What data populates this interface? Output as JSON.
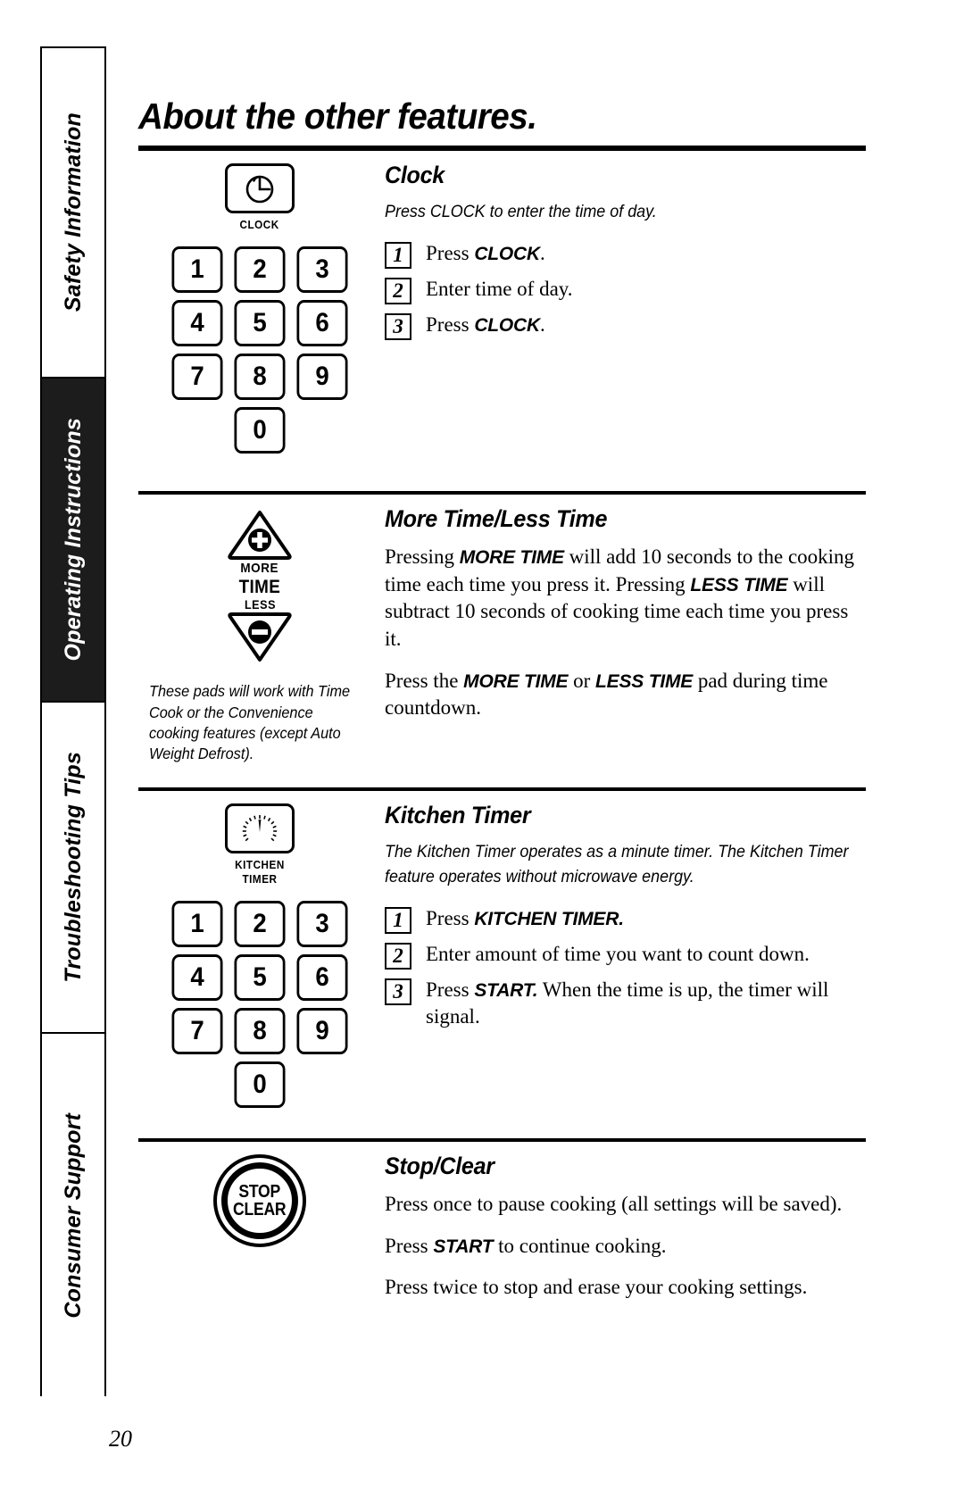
{
  "page": {
    "title": "About the other features.",
    "number": "20"
  },
  "sidebar": {
    "tabs": [
      {
        "label": "Safety Information",
        "active": false
      },
      {
        "label": "Operating Instructions",
        "active": true
      },
      {
        "label": "Troubleshooting Tips",
        "active": false
      },
      {
        "label": "Consumer Support",
        "active": false
      }
    ]
  },
  "sections": {
    "clock": {
      "heading": "Clock",
      "intro": "Press CLOCK to enter the time of day.",
      "pad_label": "CLOCK",
      "pad_icon": "clock-face-icon",
      "steps": [
        {
          "num": "1",
          "pre": "Press ",
          "strong": "CLOCK",
          "post": "."
        },
        {
          "num": "2",
          "pre": "Enter time of day.",
          "strong": "",
          "post": ""
        },
        {
          "num": "3",
          "pre": "Press ",
          "strong": "CLOCK",
          "post": "."
        }
      ],
      "keypad": [
        [
          "1",
          "2",
          "3"
        ],
        [
          "4",
          "5",
          "6"
        ],
        [
          "7",
          "8",
          "9"
        ],
        [
          "0"
        ]
      ]
    },
    "more_less_time": {
      "heading": "More Time/Less Time",
      "pad": {
        "more_label": "MORE",
        "time_label": "TIME",
        "less_label": "LESS",
        "plus_icon": "plus-in-triangle-icon",
        "minus_icon": "minus-in-triangle-icon"
      },
      "note": "These pads will work with Time Cook or the Convenience cooking features (except Auto Weight Defrost).",
      "paragraph1": {
        "p1": "Pressing ",
        "b1": "MORE TIME",
        "p2": " will add 10 seconds to the cooking time each time you press it. Pressing ",
        "b2": "LESS TIME",
        "p3": " will subtract 10 seconds of cooking time each time you press it."
      },
      "paragraph2": {
        "p1": "Press the ",
        "b1": "MORE TIME",
        "p2": " or ",
        "b2": "LESS TIME",
        "p3": " pad during time countdown."
      }
    },
    "kitchen_timer": {
      "heading": "Kitchen Timer",
      "intro": "The Kitchen Timer operates as a minute timer. The Kitchen Timer feature operates without microwave energy.",
      "pad_label_line1": "KITCHEN",
      "pad_label_line2": "TIMER",
      "pad_icon": "timer-dial-icon",
      "steps": [
        {
          "num": "1",
          "pre": "Press ",
          "strong": "KITCHEN TIMER.",
          "post": ""
        },
        {
          "num": "2",
          "pre": "Enter amount of time you want to count down.",
          "strong": "",
          "post": ""
        },
        {
          "num": "3",
          "pre": "Press ",
          "strong": "START.",
          "post": " When the time is up, the timer will signal."
        }
      ],
      "keypad": [
        [
          "1",
          "2",
          "3"
        ],
        [
          "4",
          "5",
          "6"
        ],
        [
          "7",
          "8",
          "9"
        ],
        [
          "0"
        ]
      ]
    },
    "stop_clear": {
      "heading": "Stop/Clear",
      "pad_line1": "STOP",
      "pad_line2": "CLEAR",
      "pad_icon": "stop-clear-round-button-icon",
      "paragraph1": "Press once to pause cooking (all settings will be saved).",
      "paragraph2": {
        "p1": "Press ",
        "b1": "START",
        "p2": " to continue cooking."
      },
      "paragraph3": "Press twice to stop and erase your cooking settings."
    }
  },
  "colors": {
    "ink": "#000000",
    "paper": "#ffffff",
    "tab_active_bg": "#1c1c1c"
  }
}
